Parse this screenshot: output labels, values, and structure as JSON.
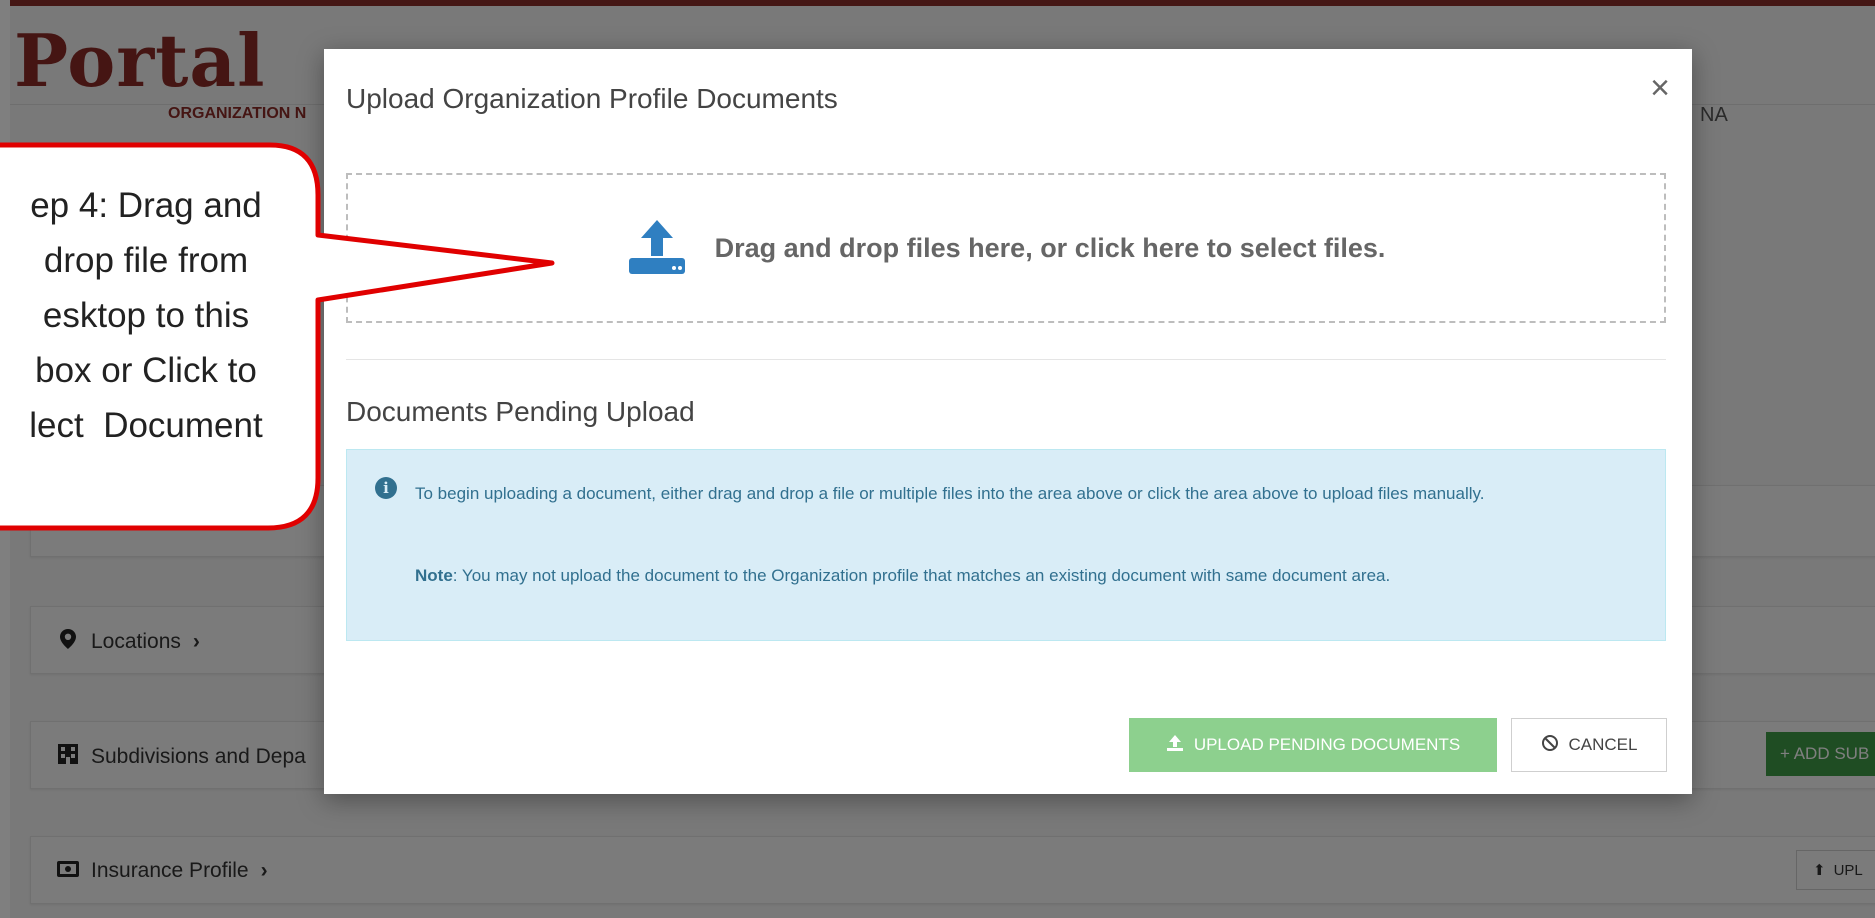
{
  "page": {
    "logo": "Portal",
    "org_label": "ORGANIZATION N",
    "right_fragment": "NA",
    "cards": [
      {
        "label": "Locations",
        "icon": "map-marker-icon"
      },
      {
        "label": "Subdivisions and Depa",
        "icon": "building-icon"
      },
      {
        "label": "Insurance Profile",
        "icon": "money-icon"
      }
    ],
    "add_sub_label": "+ ADD SUB",
    "upload_small_label": "UPL"
  },
  "modal": {
    "title": "Upload Organization Profile Documents",
    "close_glyph": "×",
    "dropzone_text": "Drag and drop files here, or click here to select files.",
    "pending_title": "Documents Pending Upload",
    "info_text": "To begin uploading a document, either drag and drop a file or multiple files into the area above or click the area above to upload files manually.",
    "note_label": "Note",
    "note_text": ": You may not upload the document to the Organization profile that matches an existing document with same document area.",
    "upload_button": "UPLOAD PENDING DOCUMENTS",
    "cancel_button": "CANCEL"
  },
  "callout": {
    "text": "ep 4: Drag and\ndrop file from\nesktop to this\nbox or Click to\nlect  Document"
  },
  "colors": {
    "brand": "#8a2b27",
    "upload_button": "#8dd08e",
    "info_bg": "#d9edf7",
    "callout_border": "#e00000"
  }
}
